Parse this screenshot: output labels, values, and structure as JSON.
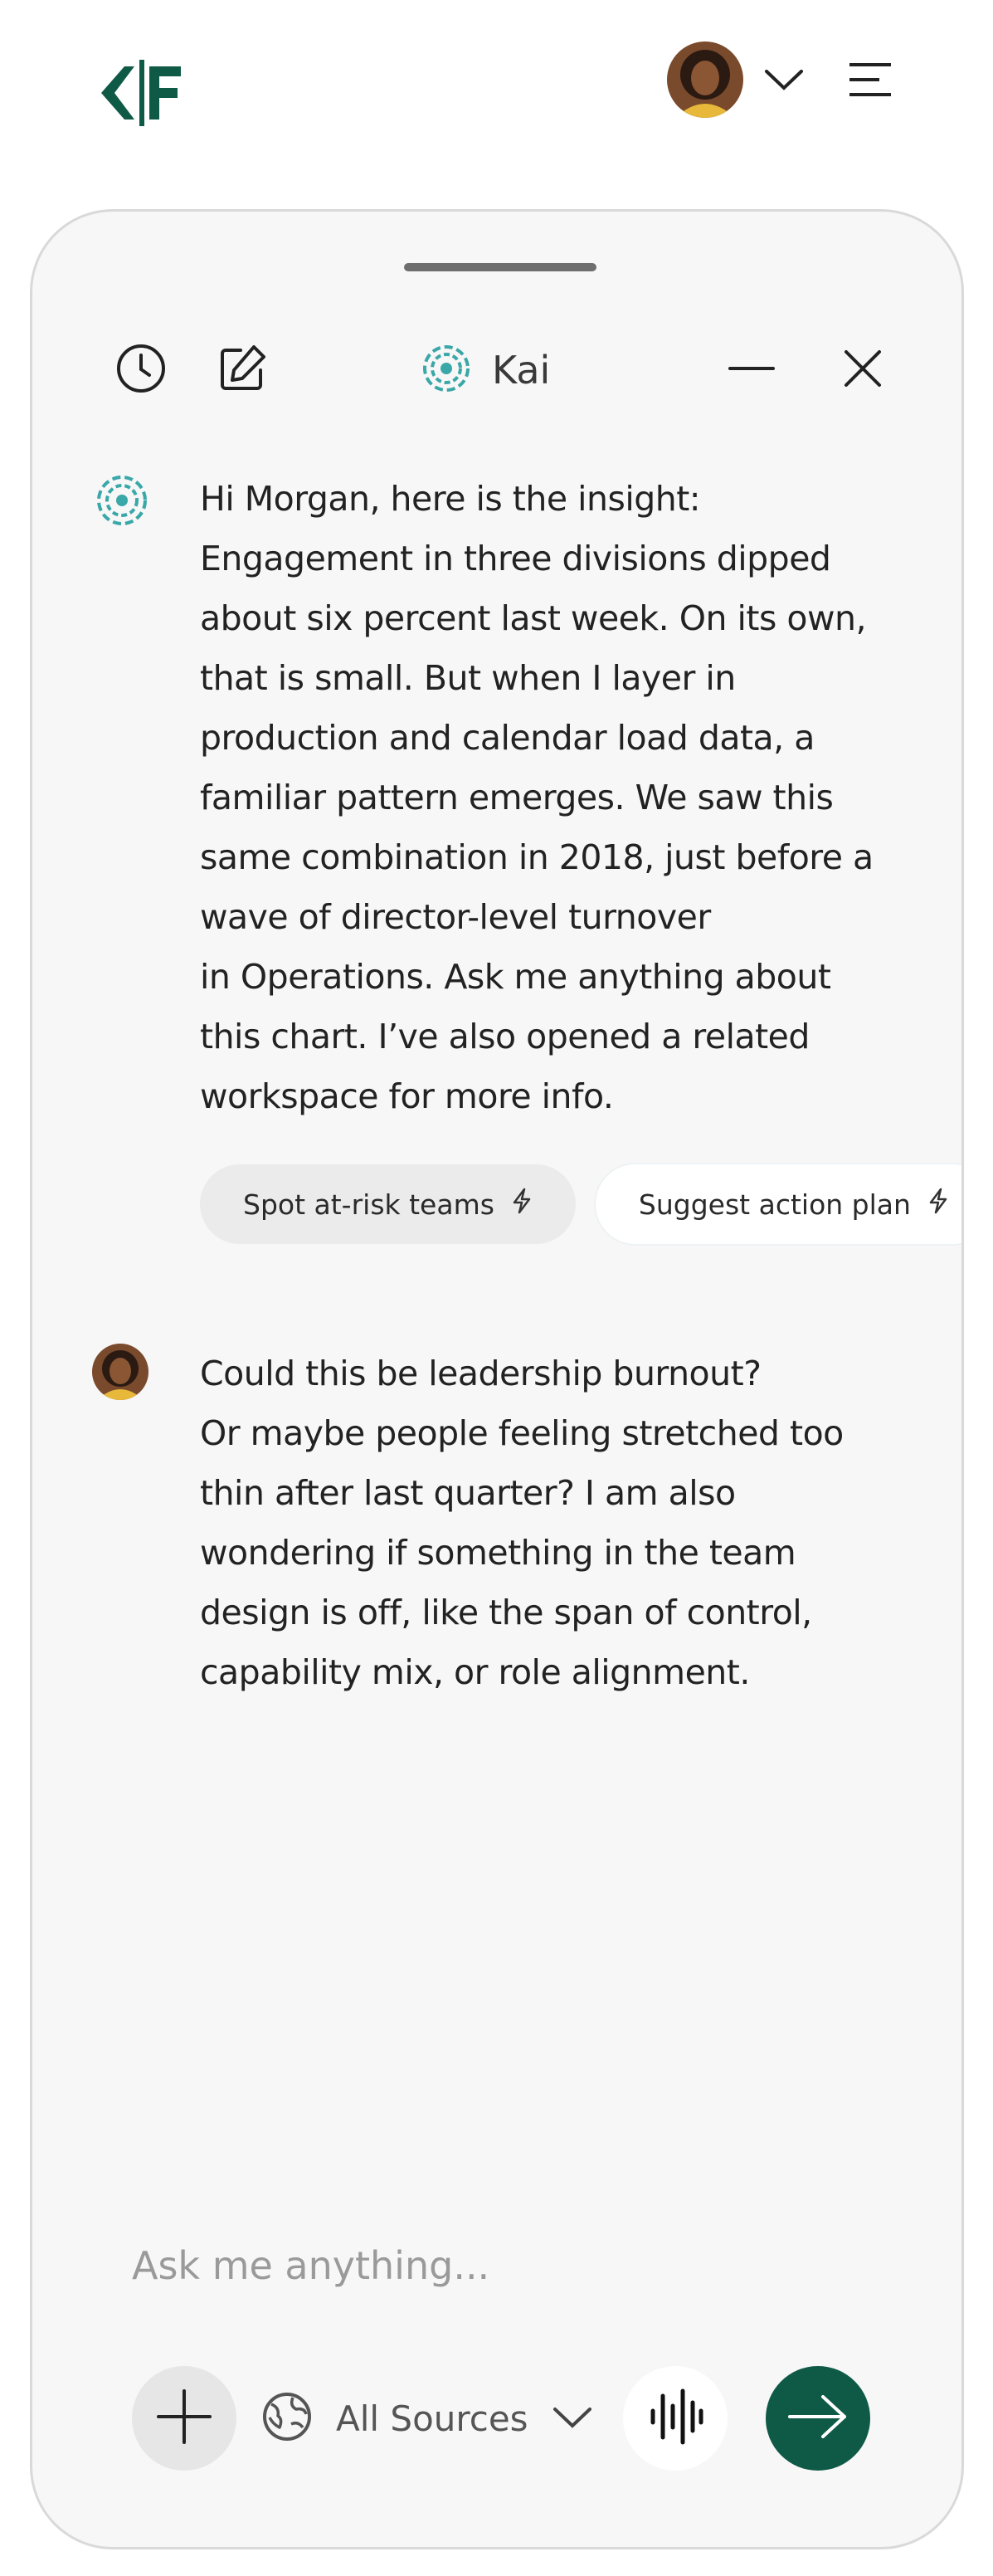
{
  "topbar": {
    "logo_icon": "cf-logo",
    "avatar_icon": "user-avatar",
    "dropdown_icon": "chevron-down-icon",
    "menu_icon": "hamburger-menu-icon"
  },
  "panel": {
    "title": "Kai",
    "history_icon": "clock-icon",
    "new_chat_icon": "edit-icon",
    "minimize_icon": "minimize-icon",
    "close_icon": "close-icon"
  },
  "conversation": {
    "bot_message_lines": [
      "Hi Morgan, here is the insight:",
      "Engagement in three divisions dipped",
      "about six percent last week. On its own,",
      "that is small. But when I layer in",
      "production and calendar load data, a",
      "familiar pattern emerges. We saw this",
      "same combination in 2018, just before a",
      "wave of director-level turnover",
      "in Operations. Ask me anything about",
      "this chart. I’ve also opened a related",
      "workspace for more info."
    ],
    "suggestions": [
      {
        "label": "Spot at-risk teams",
        "icon": "lightning-icon"
      },
      {
        "label": "Suggest action plan",
        "icon": "lightning-icon"
      }
    ],
    "user_message_lines": [
      "Could this be leadership burnout?",
      "Or maybe people feeling stretched too",
      "thin after last quarter? I am also",
      "wondering if something in the team",
      "design is off, like the span of control,",
      "capability mix, or role alignment."
    ]
  },
  "composer": {
    "placeholder": "Ask me anything...",
    "value": "",
    "sources_label": "All Sources",
    "attach_icon": "plus-icon",
    "sources_icon": "globe-icon",
    "voice_icon": "voice-waveform-icon",
    "send_icon": "arrow-right-icon"
  },
  "colors": {
    "brand": "#0f5a46",
    "bot_accent": "#3aa7a8",
    "panel_bg": "#f7f7f7"
  }
}
